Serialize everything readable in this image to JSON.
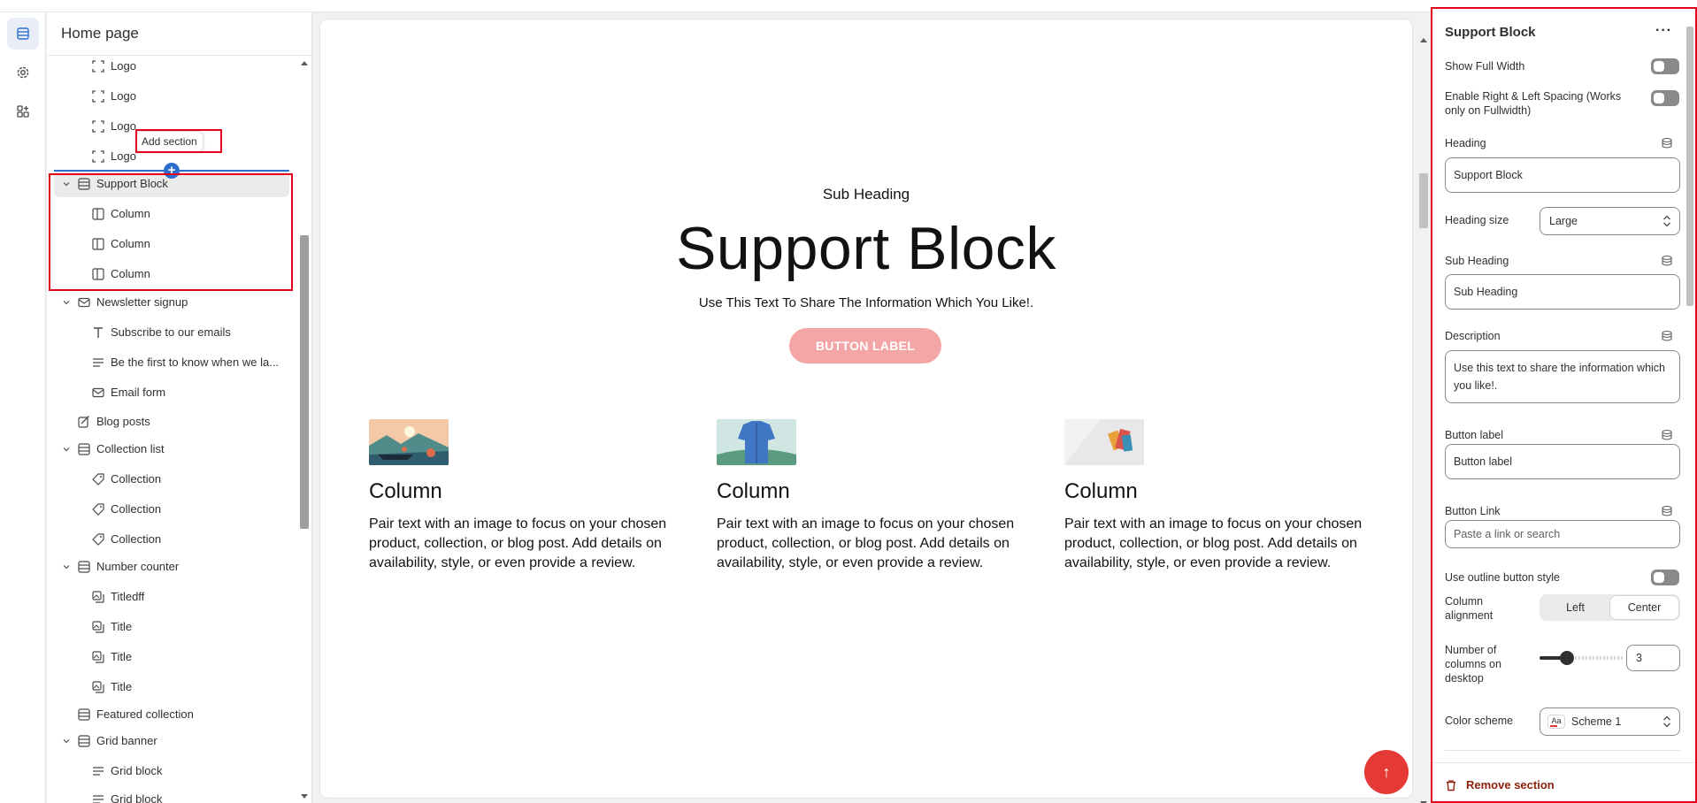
{
  "sidebar": {
    "title": "Home page",
    "add_section_tooltip": "Add section",
    "items": [
      {
        "label": "Logo",
        "icon": "logo-block-icon"
      },
      {
        "label": "Logo",
        "icon": "logo-block-icon"
      },
      {
        "label": "Logo",
        "icon": "logo-block-icon"
      },
      {
        "label": "Logo",
        "icon": "logo-block-icon"
      },
      {
        "label": "Support Block",
        "icon": "section-icon"
      },
      {
        "label": "Column",
        "icon": "column-icon"
      },
      {
        "label": "Column",
        "icon": "column-icon"
      },
      {
        "label": "Column",
        "icon": "column-icon"
      },
      {
        "label": "Newsletter signup",
        "icon": "email-icon"
      },
      {
        "label": "Subscribe to our emails",
        "icon": "text-heading-icon"
      },
      {
        "label": "Be the first to know when we la...",
        "icon": "paragraph-icon"
      },
      {
        "label": "Email form",
        "icon": "email-icon"
      },
      {
        "label": "Blog posts",
        "icon": "blog-icon"
      },
      {
        "label": "Collection list",
        "icon": "section-icon"
      },
      {
        "label": "Collection",
        "icon": "collection-tag-icon"
      },
      {
        "label": "Collection",
        "icon": "collection-tag-icon"
      },
      {
        "label": "Collection",
        "icon": "collection-tag-icon"
      },
      {
        "label": "Number counter",
        "icon": "section-icon"
      },
      {
        "label": "Titledff",
        "icon": "image-text-icon"
      },
      {
        "label": "Title",
        "icon": "image-text-icon"
      },
      {
        "label": "Title",
        "icon": "image-text-icon"
      },
      {
        "label": "Title",
        "icon": "image-text-icon"
      },
      {
        "label": "Featured collection",
        "icon": "section-icon"
      },
      {
        "label": "Grid banner",
        "icon": "section-icon"
      },
      {
        "label": "Grid block",
        "icon": "paragraph-icon"
      },
      {
        "label": "Grid block",
        "icon": "paragraph-icon"
      }
    ]
  },
  "preview": {
    "sub_heading": "Sub Heading",
    "heading": "Support Block",
    "description": "Use This Text To Share The Information Which You Like!.",
    "button_label": "BUTTON LABEL",
    "columns": [
      {
        "title": "Column",
        "text": "Pair text with an image to focus on your chosen product, collection, or blog post. Add details on availability, style, or even provide a review."
      },
      {
        "title": "Column",
        "text": "Pair text with an image to focus on your chosen product, collection, or blog post. Add details on availability, style, or even provide a review."
      },
      {
        "title": "Column",
        "text": "Pair text with an image to focus on your chosen product, collection, or blog post. Add details on availability, style, or even provide a review."
      }
    ],
    "scroll_top_icon": "arrow-up-icon"
  },
  "panel": {
    "title": "Support Block",
    "more_icon": "more-horizontal-icon",
    "show_full_width": "Show Full Width",
    "enable_spacing": "Enable Right & Left Spacing (Works only on Fullwidth)",
    "heading_label": "Heading",
    "heading_value": "Support Block",
    "heading_size_label": "Heading size",
    "heading_size_value": "Large",
    "sub_heading_label": "Sub Heading",
    "sub_heading_value": "Sub Heading",
    "description_label": "Description",
    "description_value": "Use this text to share the information which you like!.",
    "button_label_label": "Button label",
    "button_label_value": "Button label",
    "button_link_label": "Button Link",
    "button_link_placeholder": "Paste a link or search",
    "outline_label": "Use outline button style",
    "column_alignment_label": "Column alignment",
    "alignment_options": [
      "Left",
      "Center"
    ],
    "alignment_selected": "Center",
    "columns_desktop_label": "Number of columns on desktop",
    "columns_desktop_value": "3",
    "columns_desktop_fraction": 0.33,
    "color_scheme_label": "Color scheme",
    "color_scheme_chip": "Aa",
    "color_scheme_value": "Scheme 1",
    "remove_label": "Remove section"
  },
  "colors": {
    "accent_red": "#e53935",
    "highlight_box": "#e3001b",
    "preview_button": "#f4a6a6",
    "insert_blue": "#2c6ecb"
  }
}
